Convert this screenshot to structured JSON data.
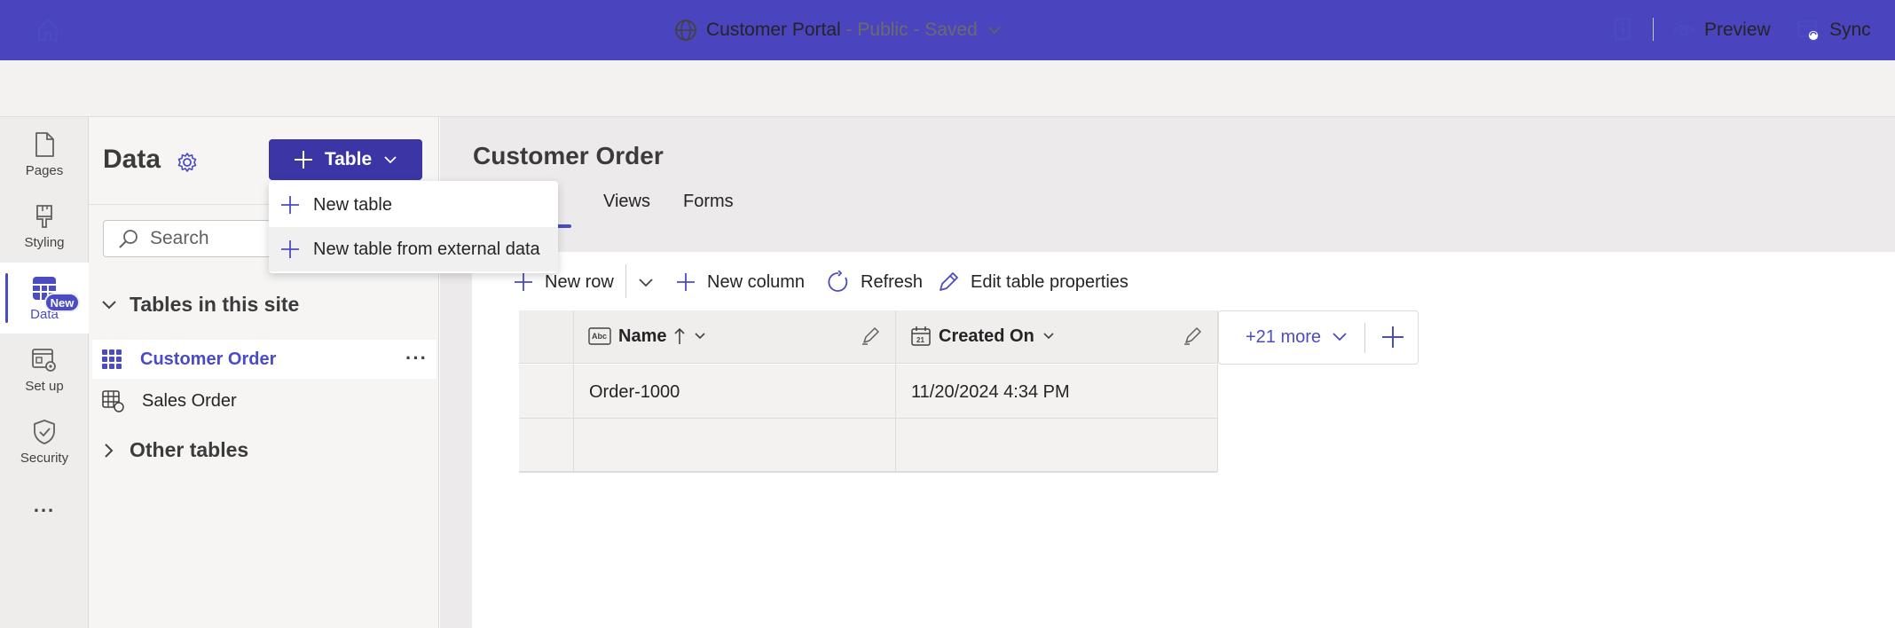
{
  "header": {
    "site_name": "Customer Portal",
    "site_status": " - Public - Saved",
    "preview_label": "Preview",
    "sync_label": "Sync"
  },
  "rail": {
    "items": [
      {
        "label": "Pages",
        "icon": "page-icon"
      },
      {
        "label": "Styling",
        "icon": "paintbrush-icon"
      },
      {
        "label": "Data",
        "icon": "table-icon",
        "active": true
      },
      {
        "label": "Set up",
        "icon": "setup-icon"
      },
      {
        "label": "Security",
        "icon": "shield-icon",
        "badge": "New"
      }
    ],
    "more": "..."
  },
  "panel": {
    "title": "Data",
    "table_button": "Table",
    "search_placeholder": "Search",
    "group_tables": "Tables in this site",
    "tables": [
      "Customer Order",
      "Sales Order"
    ],
    "group_other": "Other tables"
  },
  "menu": {
    "items": [
      "New table",
      "New table from external data"
    ]
  },
  "main": {
    "title": "Customer Order",
    "tabs": [
      "Data",
      "Views",
      "Forms"
    ],
    "tab_visible_fragment": "ta",
    "toolbar": {
      "new_row": "New row",
      "new_column": "New column",
      "refresh": "Refresh",
      "edit_props": "Edit table properties"
    },
    "columns": [
      "Name",
      "Created On"
    ],
    "rows": [
      [
        "Order-1000",
        "11/20/2024 4:34 PM"
      ],
      [
        "",
        ""
      ]
    ],
    "more_columns": "+21 more"
  },
  "colors": {
    "banner": "#4a45bf",
    "accent": "#4b4bc4",
    "primary_button": "#3b35a6"
  }
}
